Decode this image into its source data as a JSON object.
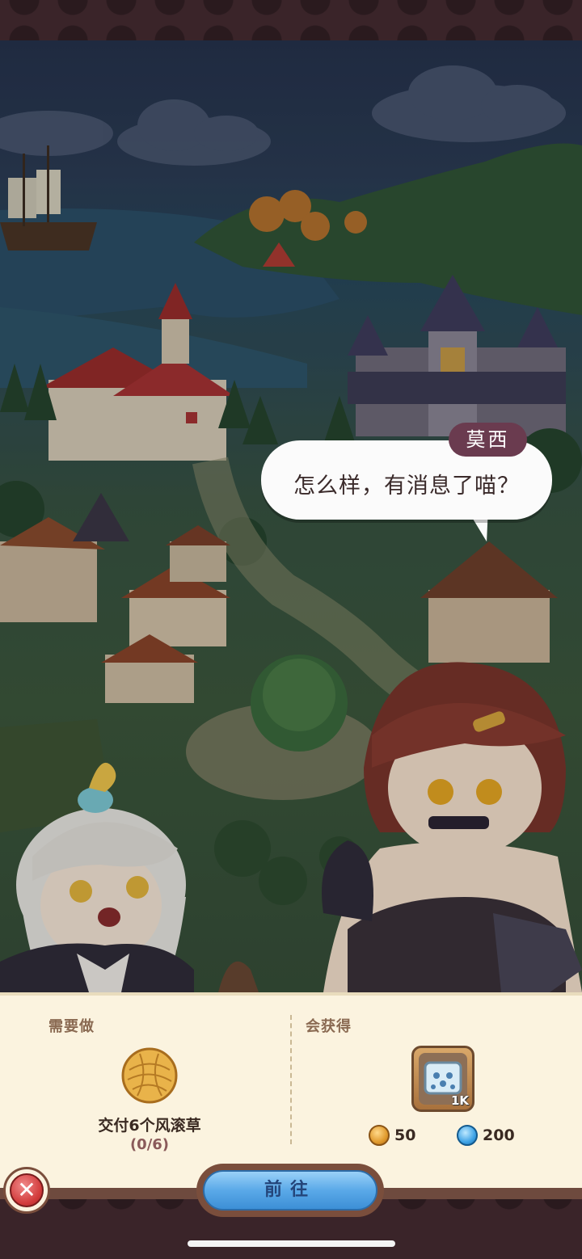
{
  "dialog": {
    "speaker": "莫西",
    "message": "怎么样，有消息了喵？"
  },
  "panel": {
    "todo_title": "需要做",
    "reward_title": "会获得",
    "task": {
      "icon": "tumbleweed-icon",
      "label": "交付6个风滚草",
      "progress": "(0/6)"
    },
    "reward_item": {
      "icon": "map-item-icon",
      "quantity": "1K"
    },
    "resources": [
      {
        "icon": "coin-icon",
        "value": "50"
      },
      {
        "icon": "water-drop-icon",
        "value": "200"
      }
    ]
  },
  "actions": {
    "close_icon": "close-icon",
    "go_label": "前往"
  },
  "colors": {
    "panel_bg": "#fbf3df",
    "name_tag": "#6a3b4f",
    "go_button": "#5aa9e8",
    "close_button": "#d23b3b"
  }
}
